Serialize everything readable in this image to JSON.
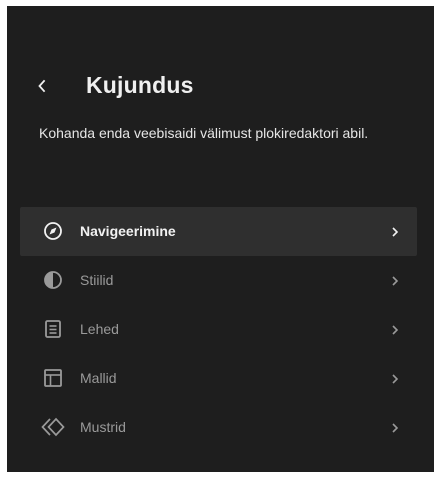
{
  "header": {
    "title": "Kujundus",
    "back_icon": "chevron-left-icon"
  },
  "description": "Kohanda enda veebisaidi välimust plokiredaktori abil.",
  "menu": {
    "items": [
      {
        "label": "Navigeerimine",
        "icon": "compass-icon",
        "active": true
      },
      {
        "label": "Stiilid",
        "icon": "half-circle-contrast-icon",
        "active": false
      },
      {
        "label": "Lehed",
        "icon": "page-icon",
        "active": false
      },
      {
        "label": "Mallid",
        "icon": "layout-template-icon",
        "active": false
      },
      {
        "label": "Mustrid",
        "icon": "patterns-diamond-icon",
        "active": false
      }
    ]
  },
  "colors": {
    "panel_background": "#1e1e1e",
    "active_item_background": "#2f2f2f",
    "active_text": "#f2f2f2",
    "inactive_text": "#9a9a9a"
  }
}
